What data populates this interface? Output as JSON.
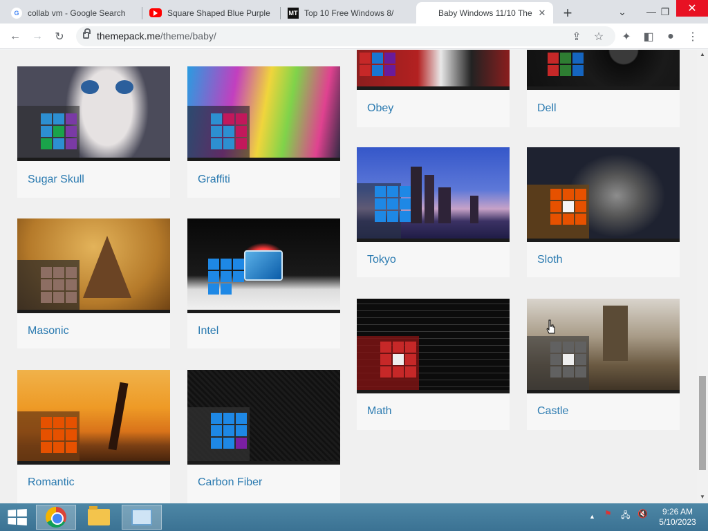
{
  "browser": {
    "tabs": [
      {
        "title": "collab vm - Google Search",
        "favicon": "google-icon"
      },
      {
        "title": "Square Shaped Blue Purple",
        "favicon": "youtube-icon"
      },
      {
        "title": "Top 10 Free Windows 8/",
        "favicon": "mt-icon"
      },
      {
        "title": "Baby Windows 11/10 The",
        "favicon": "windows-icon",
        "active": true
      }
    ],
    "new_tab": "+",
    "url_domain": "themepack.me",
    "url_path": "/theme/baby/"
  },
  "themes": [
    {
      "name": "Sugar Skull"
    },
    {
      "name": "Graffiti"
    },
    {
      "name": "Obey"
    },
    {
      "name": "Dell"
    },
    {
      "name": "Masonic"
    },
    {
      "name": "Intel"
    },
    {
      "name": "Tokyo"
    },
    {
      "name": "Sloth"
    },
    {
      "name": "Romantic"
    },
    {
      "name": "Carbon Fiber"
    },
    {
      "name": "Math"
    },
    {
      "name": "Castle"
    }
  ],
  "taskbar": {
    "time": "9:26 AM",
    "date": "5/10/2023"
  },
  "colors": {
    "link": "#2a7ab0",
    "close_button": "#e81123",
    "taskbar": "#4d87a6"
  }
}
